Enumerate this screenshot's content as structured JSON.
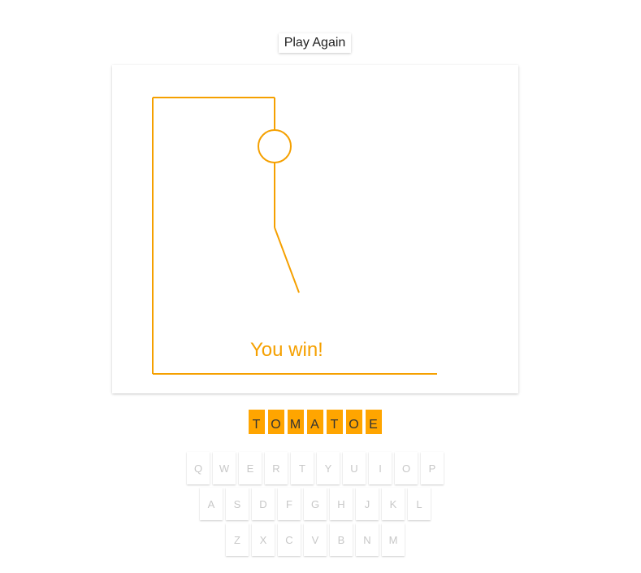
{
  "controls": {
    "play_again_label": "Play Again"
  },
  "game": {
    "status_text": "You win!",
    "word": [
      "T",
      "O",
      "M",
      "A",
      "T",
      "O",
      "E"
    ],
    "accent_color": "#ffa500"
  },
  "keyboard": {
    "rows": [
      [
        "Q",
        "W",
        "E",
        "R",
        "T",
        "Y",
        "U",
        "I",
        "O",
        "P"
      ],
      [
        "A",
        "S",
        "D",
        "F",
        "G",
        "H",
        "J",
        "K",
        "L"
      ],
      [
        "Z",
        "X",
        "C",
        "V",
        "B",
        "N",
        "M"
      ]
    ]
  }
}
